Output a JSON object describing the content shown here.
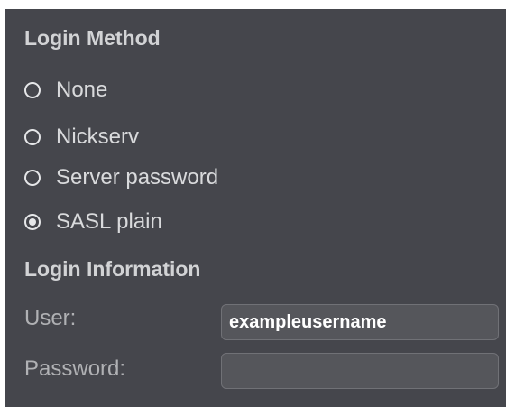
{
  "login_method": {
    "title": "Login Method",
    "options": [
      {
        "label": "None",
        "selected": false
      },
      {
        "label": "Nickserv",
        "selected": false
      },
      {
        "label": "Server password",
        "selected": false
      },
      {
        "label": "SASL plain",
        "selected": true
      }
    ]
  },
  "login_information": {
    "title": "Login Information",
    "user": {
      "label": "User:",
      "value": "exampleusername"
    },
    "password": {
      "label": "Password:",
      "value": ""
    }
  },
  "colors": {
    "panel_background": "#45464c",
    "text": "#d9dadc",
    "input_background": "#55565b"
  }
}
